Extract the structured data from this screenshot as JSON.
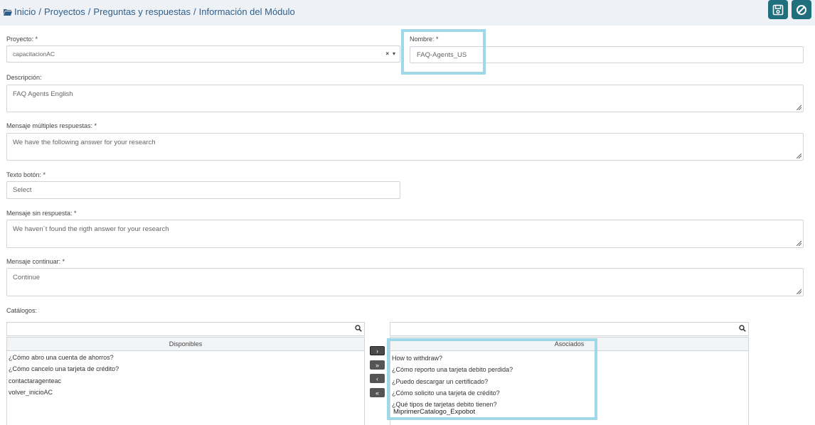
{
  "breadcrumb": [
    "Inicio",
    "Proyectos",
    "Preguntas y respuestas",
    "Información del Módulo"
  ],
  "breadcrumb_separator": "/",
  "toolbar": {
    "save_icon": "floppy-disk-icon",
    "cancel_icon": "ban-icon",
    "color": "#1f6f7d"
  },
  "form": {
    "proyecto": {
      "label": "Proyecto: *",
      "value": "capacitacionAC",
      "clear": "×",
      "caret": "▾"
    },
    "nombre": {
      "label": "Nombre: *",
      "value": "FAQ-Agents_US"
    },
    "descripcion": {
      "label": "Descripción:",
      "value": "FAQ Agents English"
    },
    "mensaje_multiples": {
      "label": "Mensaje múltiples respuestas: *",
      "value": "We have the following answer for your research"
    },
    "texto_boton": {
      "label": "Texto botón: *",
      "value": "Select"
    },
    "mensaje_sin_respuesta": {
      "label": "Mensaje sin respuesta: *",
      "value": "We haven´t found the rigth answer for your research"
    },
    "mensaje_continuar": {
      "label": "Mensaje continuar: *",
      "value": "Continue"
    },
    "catalogos": {
      "label": "Catálogos:"
    }
  },
  "catalogs": {
    "disponibles": {
      "header": "Disponibles",
      "items": [
        "¿Cómo abro una cuenta de ahorros?",
        "¿Cómo cancelo una tarjeta de crédito?",
        "contactaragenteac",
        "volver_inicioAC"
      ]
    },
    "asociados": {
      "header": "Asociados",
      "items": [
        "How to withdraw?",
        "¿Cómo reporto una tarjeta debito perdida?",
        "¿Puedo descargar un certificado?",
        "¿Cómo solicito una tarjeta de crédito?",
        "¿Qué tipos de tarjetas debito tienen?",
        "MiprimerCatalogo_Expobot"
      ]
    },
    "move_buttons": [
      "›",
      "»",
      "‹",
      "«"
    ]
  },
  "highlight_color": "#9fd8e6"
}
